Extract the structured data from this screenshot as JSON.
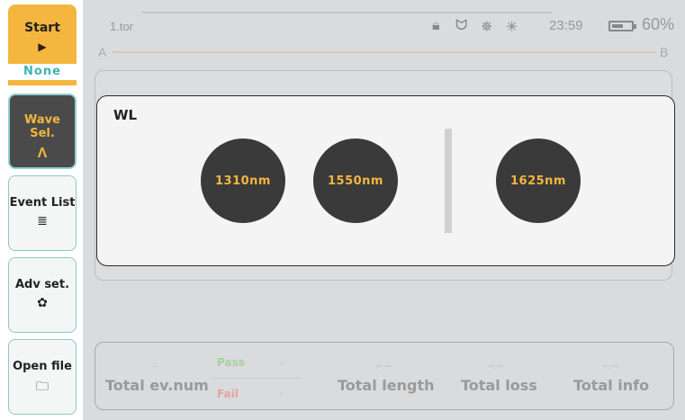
{
  "sidebar": {
    "start": {
      "label": "Start",
      "icon": "play-icon",
      "glyph": "▶",
      "status": "None"
    },
    "wave": {
      "label": "Wave Sel.",
      "icon": "caret-up-icon",
      "glyph": "Λ"
    },
    "event": {
      "label": "Event List",
      "icon": "list-icon",
      "glyph": "≣"
    },
    "adv": {
      "label": "Adv set.",
      "icon": "gear-icon",
      "glyph": "✿"
    },
    "open": {
      "label": "Open file",
      "icon": "folder-icon",
      "glyph": "🗀"
    }
  },
  "header": {
    "file_name": "1.tor",
    "icons": [
      {
        "name": "lock-icon",
        "glyph": "🔒︎"
      },
      {
        "name": "plug-icon",
        "glyph": "ᗢ"
      },
      {
        "name": "laser-icon",
        "glyph": "✵"
      },
      {
        "name": "light-icon",
        "glyph": "✳"
      }
    ],
    "time": "23:59",
    "battery_percent": "60%",
    "battery_level": 0.6
  },
  "ab": {
    "a": "A",
    "b": "B"
  },
  "wavelength": {
    "title": "WL",
    "options": [
      "1310nm",
      "1550nm",
      "1625nm"
    ]
  },
  "summary": {
    "ev_num_value": "-",
    "ev_num_label": "Total ev.num",
    "pass_label": "Pass",
    "pass_value": "-",
    "fail_label": "Fail",
    "fail_value": "-",
    "length_value": "--.--",
    "length_label": "Total length",
    "loss_value": "--.--",
    "loss_label": "Total loss",
    "info_value": "--.--",
    "info_label": "Total info"
  },
  "colors": {
    "accent": "#f4b63f",
    "teal": "#3fb5b0",
    "dark": "#3b3a3a",
    "background": "#dadbdd"
  }
}
